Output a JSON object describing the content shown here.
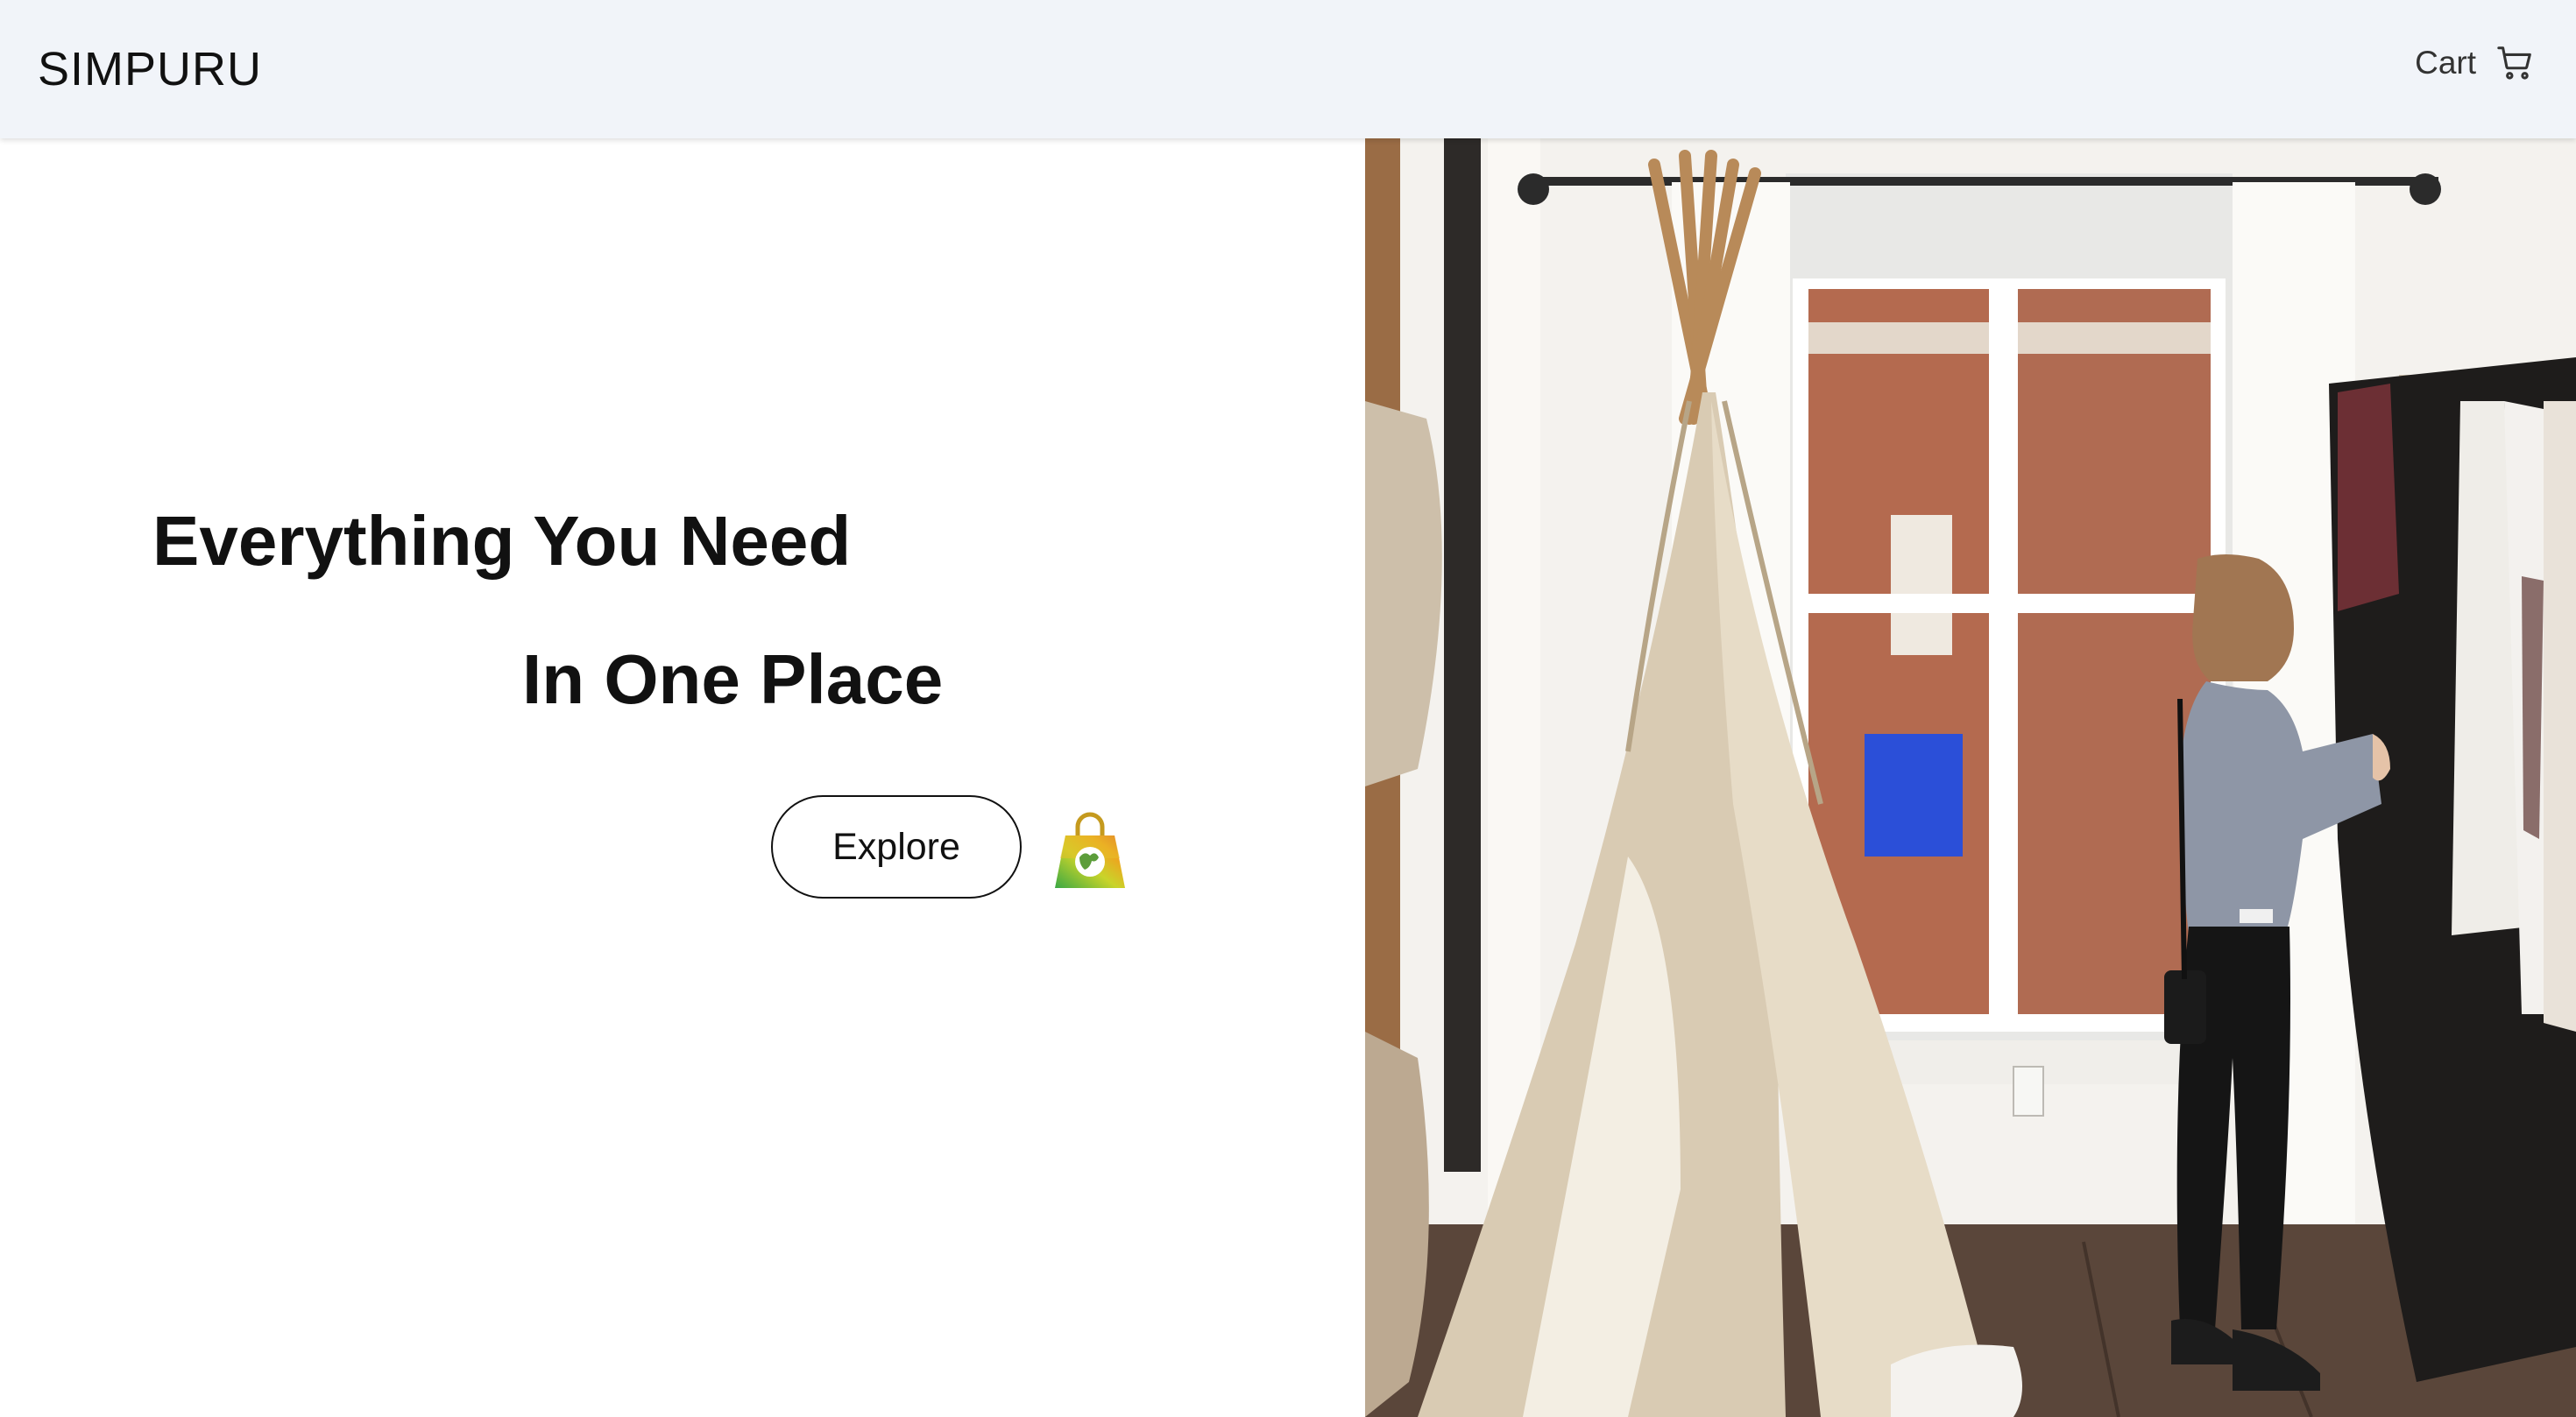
{
  "header": {
    "brand": "SIMPURU",
    "cart_label": "Cart",
    "cart_icon": "cart-icon"
  },
  "hero": {
    "headline_line1": "Everything You Need",
    "headline_line2": "In One Place",
    "cta_label": "Explore",
    "bag_icon": "shopping-bag-logo-icon",
    "image_alt": "Woman browsing clothing rack in a bright room with a teepee"
  },
  "colors": {
    "navbar_bg": "#f1f4f9",
    "text": "#111111",
    "button_border": "#111111"
  }
}
